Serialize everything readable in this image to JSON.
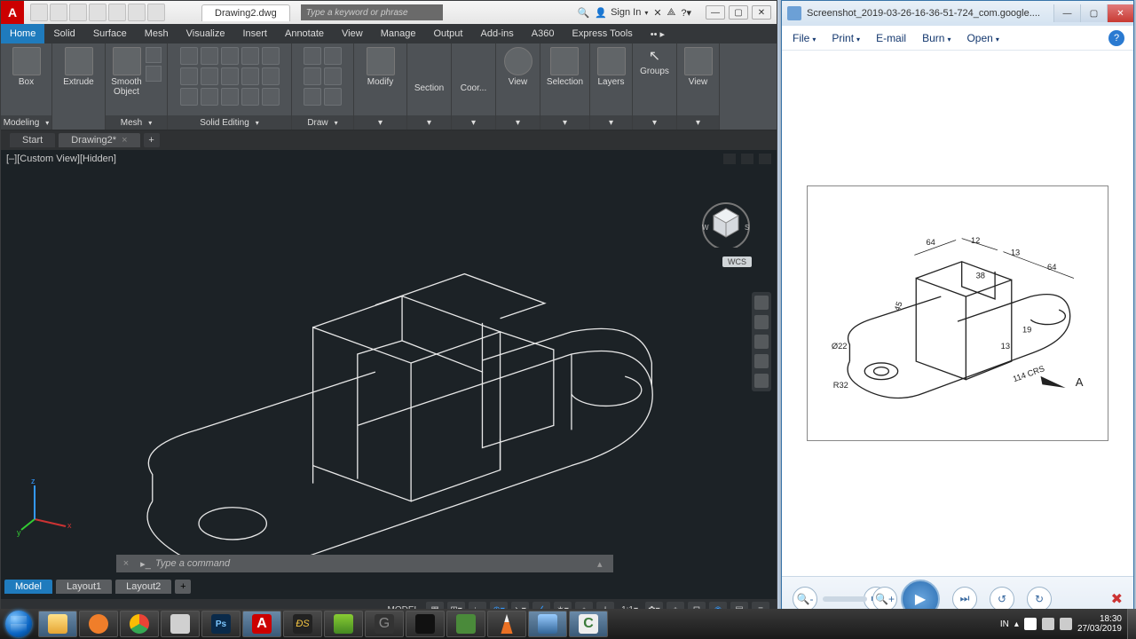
{
  "cad": {
    "titlebar": {
      "filename": "Drawing2.dwg",
      "search_placeholder": "Type a keyword or phrase",
      "signin": "Sign In"
    },
    "ribbon_tabs": [
      "Home",
      "Solid",
      "Surface",
      "Mesh",
      "Visualize",
      "Insert",
      "Annotate",
      "View",
      "Manage",
      "Output",
      "Add-ins",
      "A360",
      "Express Tools"
    ],
    "ribbon_active": "Home",
    "panels": {
      "box": "Box",
      "extrude": "Extrude",
      "smooth": "Smooth Object",
      "modeling": "Modeling",
      "mesh": "Mesh",
      "solid_editing": "Solid Editing",
      "draw": "Draw",
      "modify": "Modify",
      "section": "Section",
      "coord": "Coor...",
      "view": "View",
      "selection": "Selection",
      "layers": "Layers",
      "groups": "Groups",
      "view2": "View"
    },
    "file_tabs": {
      "start": "Start",
      "drawing": "Drawing2*"
    },
    "viewport_label": "[–][Custom View][Hidden]",
    "wcs": "WCS",
    "cmd_placeholder": "Type a command",
    "layout_tabs": [
      "Model",
      "Layout1",
      "Layout2"
    ],
    "status": {
      "model": "MODEL",
      "scale": "1:1"
    }
  },
  "viewer": {
    "title": "Screenshot_2019-03-26-16-36-51-724_com.google....",
    "menu": [
      "File",
      "Print",
      "E-mail",
      "Burn",
      "Open"
    ],
    "dimensions": {
      "d1": "64",
      "d2": "12",
      "d3": "13",
      "d4": "38",
      "d5": "45",
      "d6": "19",
      "d7": "13",
      "d8": "114 CRS",
      "phi": "Ø22",
      "r": "R32",
      "arrow": "A",
      "d9": "64"
    }
  },
  "taskbar": {
    "lang": "IN",
    "time": "18:30",
    "date": "27/03/2019"
  }
}
